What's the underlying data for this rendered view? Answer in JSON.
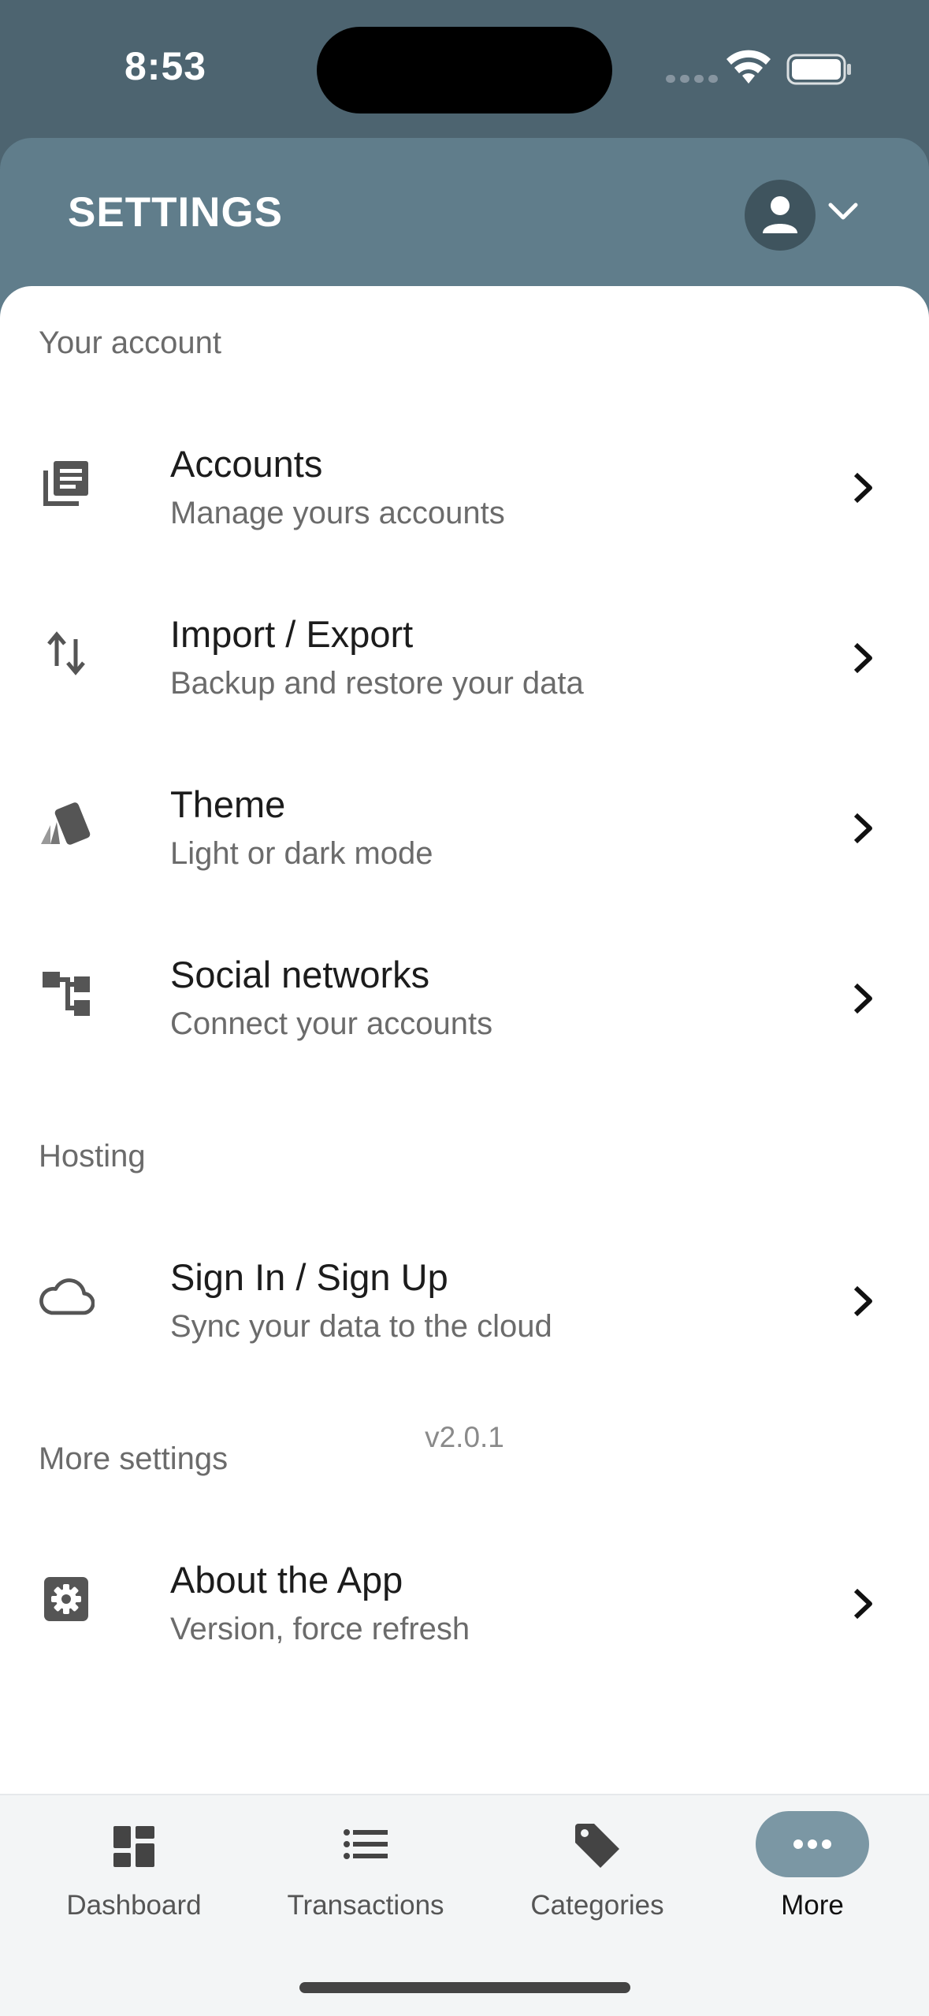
{
  "status": {
    "time": "8:53"
  },
  "header": {
    "title": "SETTINGS"
  },
  "sections": {
    "account": "Your account",
    "hosting": "Hosting",
    "more": "More settings"
  },
  "items": {
    "accounts": {
      "title": "Accounts",
      "subtitle": "Manage yours accounts",
      "icon": "list-icon"
    },
    "import_export": {
      "title": "Import / Export",
      "subtitle": "Backup and restore your data",
      "icon": "swap-vertical-icon"
    },
    "theme": {
      "title": "Theme",
      "subtitle": "Light or dark mode",
      "icon": "palette-swatch-icon"
    },
    "social": {
      "title": "Social networks",
      "subtitle": "Connect your accounts",
      "icon": "network-tree-icon"
    },
    "signin": {
      "title": "Sign In / Sign Up",
      "subtitle": "Sync your data to the cloud",
      "icon": "cloud-icon"
    },
    "about": {
      "title": "About the App",
      "subtitle": "Version, force refresh",
      "icon": "gear-icon"
    }
  },
  "version": "v2.0.1",
  "nav": {
    "dashboard": "Dashboard",
    "transactions": "Transactions",
    "categories": "Categories",
    "more": "More",
    "active": "more"
  },
  "colors": {
    "header": "#607d8b",
    "status_bar": "#4d6470",
    "accent_pill": "#7b97a4",
    "avatar": "#3f545e"
  }
}
